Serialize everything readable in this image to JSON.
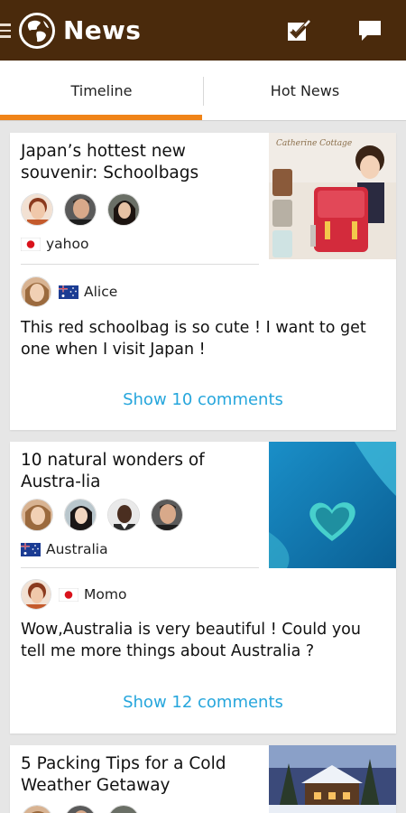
{
  "app": {
    "title": "News",
    "icons": {
      "menu": "hamburger-menu-icon",
      "logo": "globe-icon",
      "check": "checkbox-icon",
      "chat": "chat-bubble-icon"
    }
  },
  "tabs": [
    {
      "label": "Timeline",
      "active": true
    },
    {
      "label": "Hot News",
      "active": false
    }
  ],
  "colors": {
    "appbar": "#4a2a0c",
    "accent": "#f08418",
    "link": "#26a6dc"
  },
  "feed": [
    {
      "title": "Japan’s hottest new souvenir: Schoolbags",
      "image_text": "Catherine Cottage",
      "source": {
        "flag": "japan-flag-icon",
        "name": "yahoo"
      },
      "comment": {
        "user": "Alice",
        "flag": "australia-flag-icon",
        "text": "This red schoolbag is so cute ! I want to get one when I visit Japan !"
      },
      "show_comments": "Show 10 comments"
    },
    {
      "title": "10 natural wonders of Austra-lia",
      "source": {
        "flag": "australia-flag-icon",
        "name": "Australia"
      },
      "comment": {
        "user": "Momo",
        "flag": "japan-flag-icon",
        "text": "Wow,Australia is very beautiful !  Could you tell me more things about Australia ?"
      },
      "show_comments": "Show 12 comments"
    },
    {
      "title": "5 Packing Tips for a Cold Weather Getaway"
    }
  ]
}
